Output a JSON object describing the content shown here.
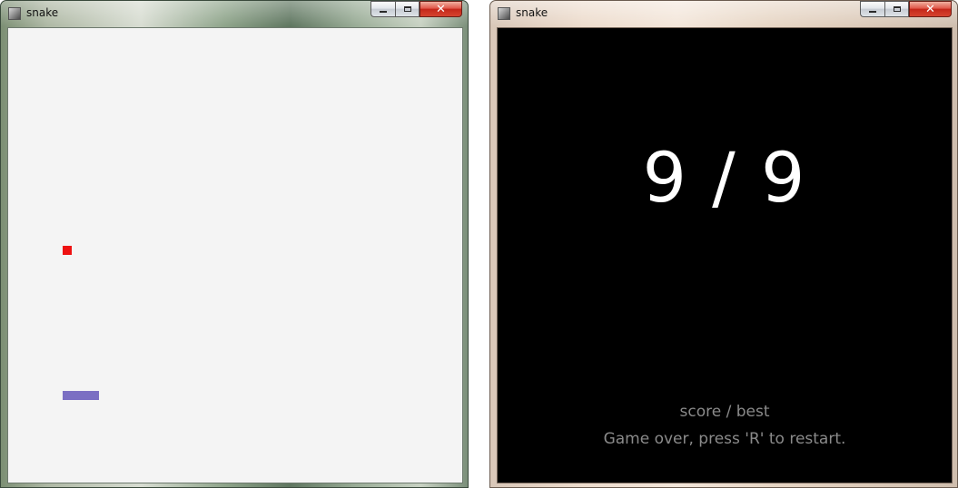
{
  "colors": {
    "food": "#ee1111",
    "snake": "#7b6fc3",
    "board_background": "#f4f4f4",
    "gameover_background": "#000000",
    "score_text": "#ffffff",
    "hint_text": "#8a8a8a"
  },
  "window_left": {
    "title": "snake",
    "icon": "app-icon",
    "buttons": {
      "minimize": "minimize",
      "maximize": "maximize",
      "close": "✕"
    }
  },
  "window_right": {
    "title": "snake",
    "icon": "app-icon",
    "buttons": {
      "minimize": "minimize",
      "maximize": "maximize",
      "close": "✕"
    },
    "game_over": {
      "score_display": "9 / 9",
      "caption": "score / best",
      "hint": "Game over, press 'R' to restart."
    }
  }
}
